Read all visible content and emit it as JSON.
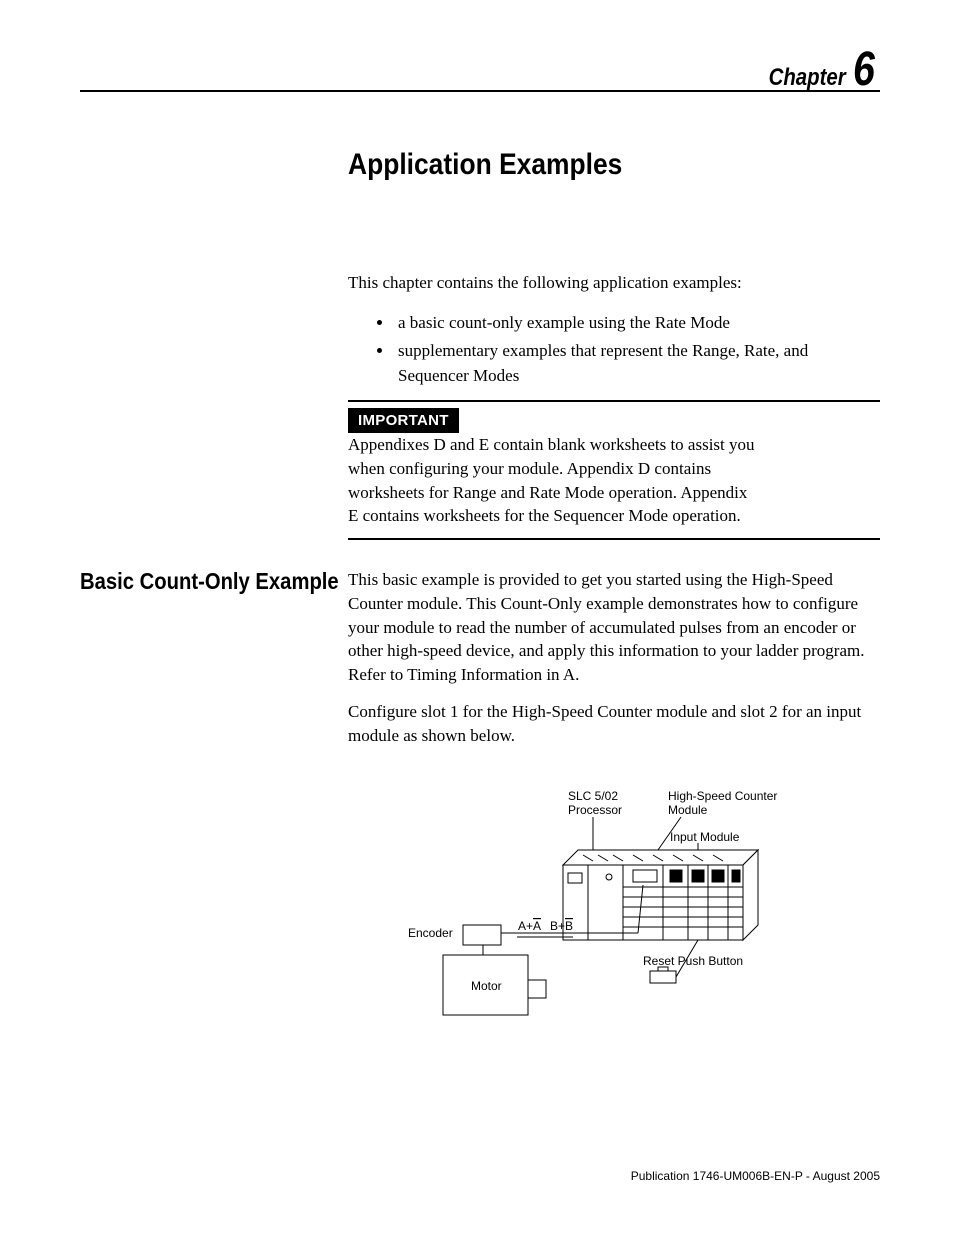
{
  "header": {
    "chapter_label": "Chapter",
    "chapter_number": "6"
  },
  "title": "Application Examples",
  "intro": "This chapter contains the following application examples:",
  "bullets": [
    "a basic count-only example using the Rate Mode",
    "supplementary examples that represent the Range, Rate, and Sequencer Modes"
  ],
  "important": {
    "label": "IMPORTANT",
    "text": "Appendixes D and E contain blank worksheets to assist you when configuring your module. Appendix D contains worksheets for Range and Rate Mode operation. Appendix E contains worksheets for the Sequencer Mode operation."
  },
  "section": {
    "heading": "Basic Count-Only Example",
    "para1": "This basic example is provided to get you started using the High-Speed Counter module. This Count-Only example demonstrates how to configure your module to read the number of accumulated pulses from an encoder or other high-speed device, and apply this information to your ladder program. Refer to Timing Information in A.",
    "para2": "Configure slot 1 for the High-Speed Counter module and slot 2 for an input module as shown below."
  },
  "diagram_labels": {
    "slc": "SLC 5/02",
    "processor": "Processor",
    "hsc1": "High-Speed Counter",
    "hsc2": "Module",
    "input_module": "Input Module",
    "encoder": "Encoder",
    "ab_signals": "A+A  B+B",
    "motor": "Motor",
    "reset": "Reset Push Button"
  },
  "footer": "Publication 1746-UM006B-EN-P - August 2005"
}
